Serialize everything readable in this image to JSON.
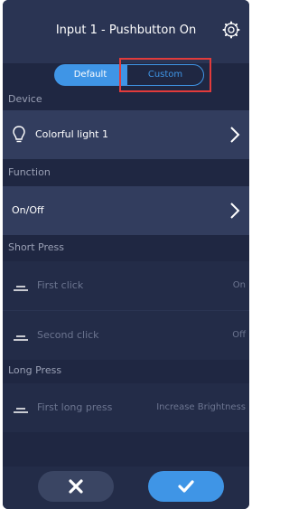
{
  "header": {
    "title": "Input 1 - Pushbutton On",
    "settings_icon": "gear-icon"
  },
  "mode_toggle": {
    "options": [
      "Default",
      "Custom"
    ],
    "selected": "Default",
    "accent_color": "#3f95e6",
    "highlight_color": "#e23b3b"
  },
  "device": {
    "section_label": "Device",
    "value": "Colorful light 1",
    "icon": "bulb-icon"
  },
  "function": {
    "section_label": "Function",
    "value": "On/Off"
  },
  "short_press": {
    "section_label": "Short Press",
    "items": [
      {
        "label": "First click",
        "value": "On"
      },
      {
        "label": "Second click",
        "value": "Off"
      }
    ]
  },
  "long_press": {
    "section_label": "Long Press",
    "items": [
      {
        "label": "First long press",
        "value": "Increase Brightness"
      }
    ]
  },
  "footer": {
    "cancel_icon": "close-icon",
    "confirm_icon": "check-icon"
  }
}
